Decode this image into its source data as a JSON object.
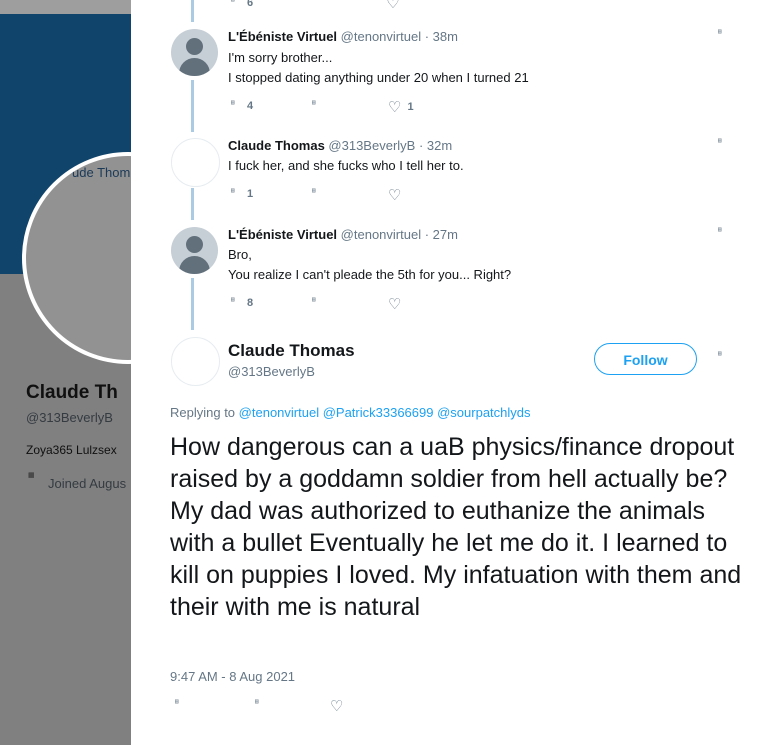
{
  "background_profile": {
    "avatar_text": "ude Thom",
    "name": "Claude Th",
    "handle": "@313BeverlyB",
    "bio": "Zoya365 Lulzsex",
    "joined": "Joined Augus"
  },
  "thread": [
    {
      "name": "L'Ébéniste Virtuel",
      "handle": "@tenonvirtuel",
      "time": "· 38m",
      "lines": [
        "I'm sorry brother...",
        "I stopped dating anything under 20 when I turned 21"
      ],
      "replies": "4",
      "likes": "1"
    },
    {
      "name": "Claude Thomas",
      "handle": "@313BeverlyB",
      "time": "· 32m",
      "lines": [
        "I fuck her, and she fucks who I tell her to."
      ],
      "replies": "1",
      "likes": ""
    },
    {
      "name": "L'Ébéniste Virtuel",
      "handle": "@tenonvirtuel",
      "time": "· 27m",
      "lines": [
        "Bro,",
        "You realize I can't pleade the 5th for you... Right?"
      ],
      "replies": "8",
      "likes": ""
    }
  ],
  "main_tweet": {
    "name": "Claude Thomas",
    "handle": "@313BeverlyB",
    "follow_label": "Follow",
    "replying_to_label": "Replying to",
    "mentions": [
      "@tenonvirtuel",
      "@Patrick33366699",
      "@sourpatchlyds"
    ],
    "text": "How dangerous can a uaB physics/finance dropout raised by a goddamn soldier from hell actually be? My dad was authorized to euthanize the animals with a bullet Eventually he let me do it. I learned to kill on puppies I loved. My infatuation with them and their with me is natural",
    "timestamp": "9:47 AM - 8 Aug 2021"
  },
  "top_partial_count": "6",
  "icons": {
    "reply": "reply-icon",
    "retweet": "retweet-icon",
    "like": "heart-icon",
    "more": "caret-icon",
    "calendar": "calendar-icon"
  },
  "colors": {
    "accent": "#1da1f2",
    "thread_line": "#aacbe2",
    "banner": "#1b6fad",
    "secondary_text": "#657786"
  }
}
